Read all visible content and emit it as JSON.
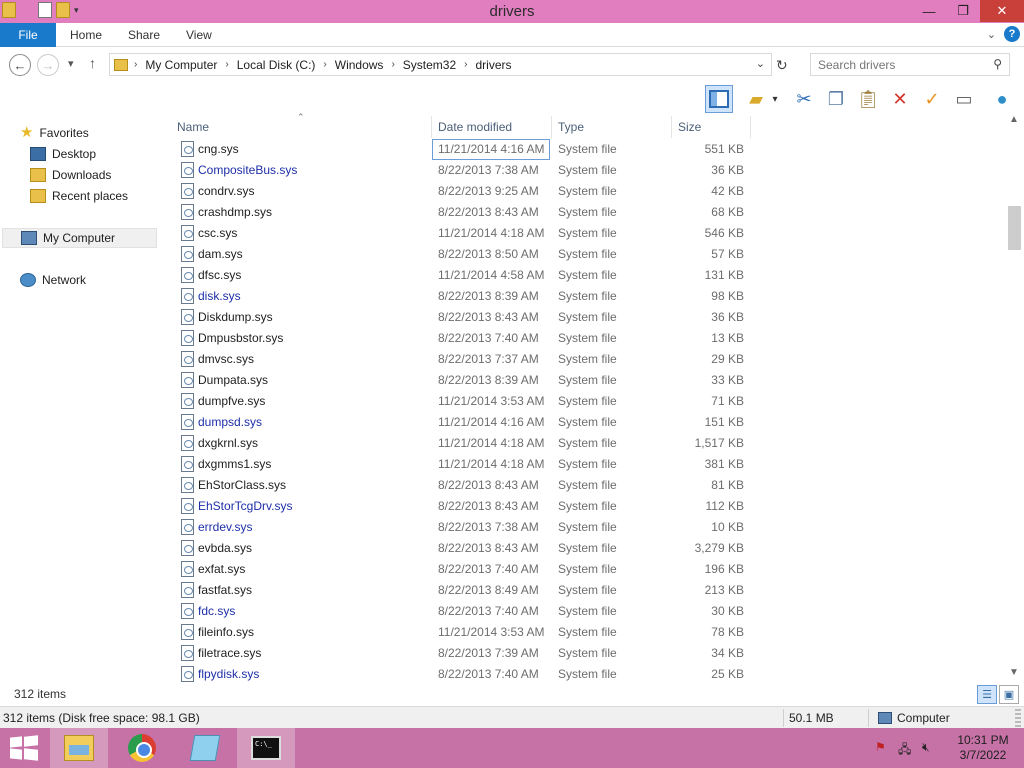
{
  "window": {
    "title": "drivers",
    "minimize": "—",
    "maximize": "❐",
    "close": "✕"
  },
  "ribbon": {
    "file": "File",
    "home": "Home",
    "share": "Share",
    "view": "View",
    "help": "?"
  },
  "address": {
    "crumbs": [
      "My Computer",
      "Local Disk (C:)",
      "Windows",
      "System32",
      "drivers"
    ]
  },
  "search": {
    "placeholder": "Search drivers"
  },
  "navpane": {
    "favorites": "Favorites",
    "desktop": "Desktop",
    "downloads": "Downloads",
    "recent": "Recent places",
    "computer": "My Computer",
    "network": "Network"
  },
  "columns": {
    "name": "Name",
    "date": "Date modified",
    "type": "Type",
    "size": "Size"
  },
  "files": [
    {
      "name": "cng.sys",
      "date": "11/21/2014 4:16 AM",
      "type": "System file",
      "size": "551 KB",
      "blue": false
    },
    {
      "name": "CompositeBus.sys",
      "date": "8/22/2013 7:38 AM",
      "type": "System file",
      "size": "36 KB",
      "blue": true
    },
    {
      "name": "condrv.sys",
      "date": "8/22/2013 9:25 AM",
      "type": "System file",
      "size": "42 KB",
      "blue": false
    },
    {
      "name": "crashdmp.sys",
      "date": "8/22/2013 8:43 AM",
      "type": "System file",
      "size": "68 KB",
      "blue": false
    },
    {
      "name": "csc.sys",
      "date": "11/21/2014 4:18 AM",
      "type": "System file",
      "size": "546 KB",
      "blue": false
    },
    {
      "name": "dam.sys",
      "date": "8/22/2013 8:50 AM",
      "type": "System file",
      "size": "57 KB",
      "blue": false
    },
    {
      "name": "dfsc.sys",
      "date": "11/21/2014 4:58 AM",
      "type": "System file",
      "size": "131 KB",
      "blue": false
    },
    {
      "name": "disk.sys",
      "date": "8/22/2013 8:39 AM",
      "type": "System file",
      "size": "98 KB",
      "blue": true
    },
    {
      "name": "Diskdump.sys",
      "date": "8/22/2013 8:43 AM",
      "type": "System file",
      "size": "36 KB",
      "blue": false
    },
    {
      "name": "Dmpusbstor.sys",
      "date": "8/22/2013 7:40 AM",
      "type": "System file",
      "size": "13 KB",
      "blue": false
    },
    {
      "name": "dmvsc.sys",
      "date": "8/22/2013 7:37 AM",
      "type": "System file",
      "size": "29 KB",
      "blue": false
    },
    {
      "name": "Dumpata.sys",
      "date": "8/22/2013 8:39 AM",
      "type": "System file",
      "size": "33 KB",
      "blue": false
    },
    {
      "name": "dumpfve.sys",
      "date": "11/21/2014 3:53 AM",
      "type": "System file",
      "size": "71 KB",
      "blue": false
    },
    {
      "name": "dumpsd.sys",
      "date": "11/21/2014 4:16 AM",
      "type": "System file",
      "size": "151 KB",
      "blue": true
    },
    {
      "name": "dxgkrnl.sys",
      "date": "11/21/2014 4:18 AM",
      "type": "System file",
      "size": "1,517 KB",
      "blue": false
    },
    {
      "name": "dxgmms1.sys",
      "date": "11/21/2014 4:18 AM",
      "type": "System file",
      "size": "381 KB",
      "blue": false
    },
    {
      "name": "EhStorClass.sys",
      "date": "8/22/2013 8:43 AM",
      "type": "System file",
      "size": "81 KB",
      "blue": false
    },
    {
      "name": "EhStorTcgDrv.sys",
      "date": "8/22/2013 8:43 AM",
      "type": "System file",
      "size": "112 KB",
      "blue": true
    },
    {
      "name": "errdev.sys",
      "date": "8/22/2013 7:38 AM",
      "type": "System file",
      "size": "10 KB",
      "blue": true
    },
    {
      "name": "evbda.sys",
      "date": "8/22/2013 8:43 AM",
      "type": "System file",
      "size": "3,279 KB",
      "blue": false
    },
    {
      "name": "exfat.sys",
      "date": "8/22/2013 7:40 AM",
      "type": "System file",
      "size": "196 KB",
      "blue": false
    },
    {
      "name": "fastfat.sys",
      "date": "8/22/2013 8:49 AM",
      "type": "System file",
      "size": "213 KB",
      "blue": false
    },
    {
      "name": "fdc.sys",
      "date": "8/22/2013 7:40 AM",
      "type": "System file",
      "size": "30 KB",
      "blue": true
    },
    {
      "name": "fileinfo.sys",
      "date": "11/21/2014 3:53 AM",
      "type": "System file",
      "size": "78 KB",
      "blue": false
    },
    {
      "name": "filetrace.sys",
      "date": "8/22/2013 7:39 AM",
      "type": "System file",
      "size": "34 KB",
      "blue": false
    },
    {
      "name": "flpydisk.sys",
      "date": "8/22/2013 7:40 AM",
      "type": "System file",
      "size": "25 KB",
      "blue": true
    }
  ],
  "status": {
    "count": "312 items",
    "info": "312 items (Disk free space: 98.1 GB)",
    "size": "50.1 MB",
    "location": "Computer"
  },
  "taskbar": {
    "time": "10:31 PM",
    "date": "3/7/2022",
    "cmd_text": "C:\\_"
  },
  "colors": {
    "titlebar": "#e07ec0",
    "taskbar": "#c672a6",
    "file_tab": "#1979ca",
    "link_blue": "#1e2fa8"
  }
}
